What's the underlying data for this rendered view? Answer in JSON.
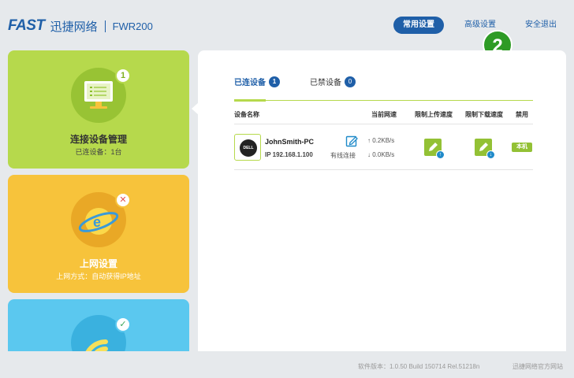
{
  "header": {
    "logo_brand": "FAST",
    "logo_cn": "迅捷网络",
    "model": "FWR200"
  },
  "nav": {
    "common": "常用设置",
    "advanced": "高级设置",
    "logout": "安全退出"
  },
  "step_badge": "2",
  "tiles": [
    {
      "title": "连接设备管理",
      "subtitle": "已连设备：1台",
      "badge": "1",
      "icon": "monitor-icon"
    },
    {
      "title": "上网设置",
      "subtitle": "上网方式：自动获得IP地址",
      "badge": "✕",
      "icon": "internet-globe-icon"
    },
    {
      "title": "",
      "subtitle": "",
      "badge": "✓",
      "icon": "wireless-icon"
    }
  ],
  "tabs": [
    {
      "label": "已连设备",
      "count": "1"
    },
    {
      "label": "已禁设备",
      "count": "0"
    }
  ],
  "table": {
    "headers": [
      "设备名称",
      "当前网速",
      "限制上传速度",
      "限制下载速度",
      "禁用"
    ],
    "rows": [
      {
        "name": "JohnSmith-PC",
        "ip": "IP 192.168.1.100",
        "connection": "有线连接",
        "up_speed": "0.2KB/s",
        "down_speed": "0.0KB/s",
        "disable": "本机",
        "device_logo": "DELL"
      }
    ]
  },
  "footer": {
    "version": "软件版本：1.0.50 Build 150714 Rel.51218n",
    "site": "迅捷网络官方网站"
  },
  "colors": {
    "brand": "#1f5fa8",
    "tile_green": "#b6d94c",
    "tile_yellow": "#f7c33b",
    "tile_blue": "#5bc8ef",
    "step_green": "#2e9b25"
  }
}
